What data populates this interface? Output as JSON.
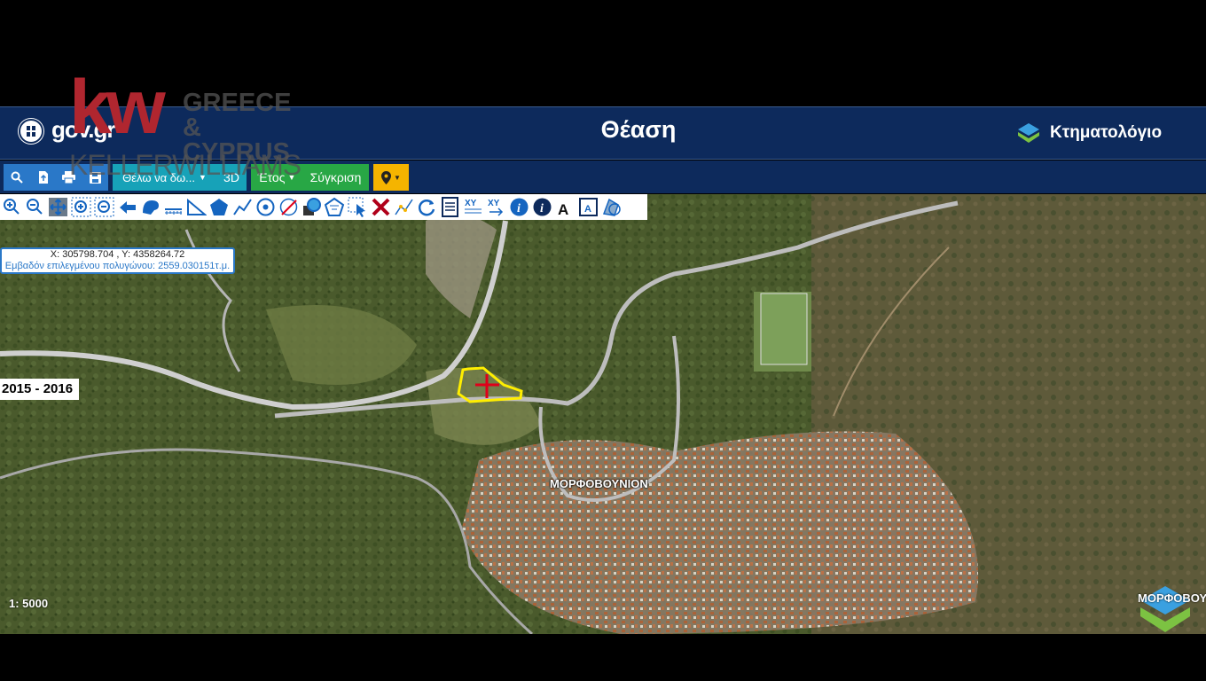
{
  "header": {
    "gov_logo": "gov.gr",
    "title": "Θέαση",
    "brand": "Κτηματολόγιο"
  },
  "watermark": {
    "mark": "kw",
    "region_line1": "GREECE &",
    "region_line2": "CYPRUS",
    "name": "KELLERWILLIAMS"
  },
  "toolbar": {
    "search_icon": "search-icon",
    "upload_icon": "file-upload-icon",
    "print_icon": "print-icon",
    "save_icon": "save-icon",
    "view_dropdown_label": "Θέλω να δω...",
    "threed_label": "3D",
    "year_dropdown_label": "Έτος",
    "compare_label": "Σύγκριση",
    "location_icon": "map-pin-icon"
  },
  "tools": [
    "zoom-in",
    "zoom-out",
    "pan",
    "zoom-box-in",
    "zoom-box-out",
    "back",
    "select-parcel",
    "measure-distance",
    "measure-angle",
    "draw-polygon",
    "draw-polyline",
    "draw-circle",
    "erase-shape",
    "identify-area",
    "identify-polygon",
    "select-polygon",
    "delete",
    "edit-vertex",
    "refresh",
    "report",
    "xy-coords",
    "xy-goto",
    "info",
    "info-2",
    "text-label",
    "legend",
    "layers"
  ],
  "map": {
    "coords_line1": "X: 305798.704 , Y: 4358264.72",
    "coords_line2": "Εμβαδόν επιλεγμένου πολυγώνου: 2559.030151τ.μ.",
    "year_label": "2015 - 2016",
    "place_label": "ΜΟΡΦΟΒΟΥΝΙΟΝ",
    "place_label_2": "ΜΟΡΦΟΒΟΥΝΙΟΝ",
    "scale_label": "1: 5000"
  },
  "colors": {
    "header_bg": "#0d2a5c",
    "parcel_outline": "#ffee00",
    "marker": "#e0001a"
  }
}
